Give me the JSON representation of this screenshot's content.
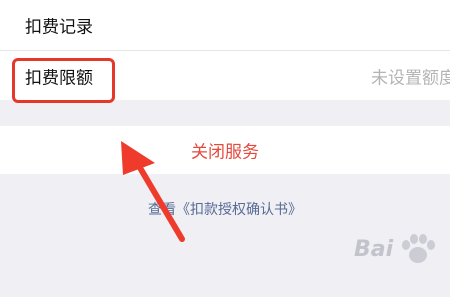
{
  "rows": {
    "record_label": "扣费记录",
    "limit_label": "扣费限额",
    "limit_value": "未设置额度"
  },
  "actions": {
    "close_service": "关闭服务",
    "agreement_link": "查看《扣款授权确认书》"
  },
  "watermark": {
    "text": "Bai"
  },
  "colors": {
    "highlight": "#e5382b",
    "close_text": "#e5493d",
    "link": "#576b95",
    "background": "#efeff4"
  }
}
